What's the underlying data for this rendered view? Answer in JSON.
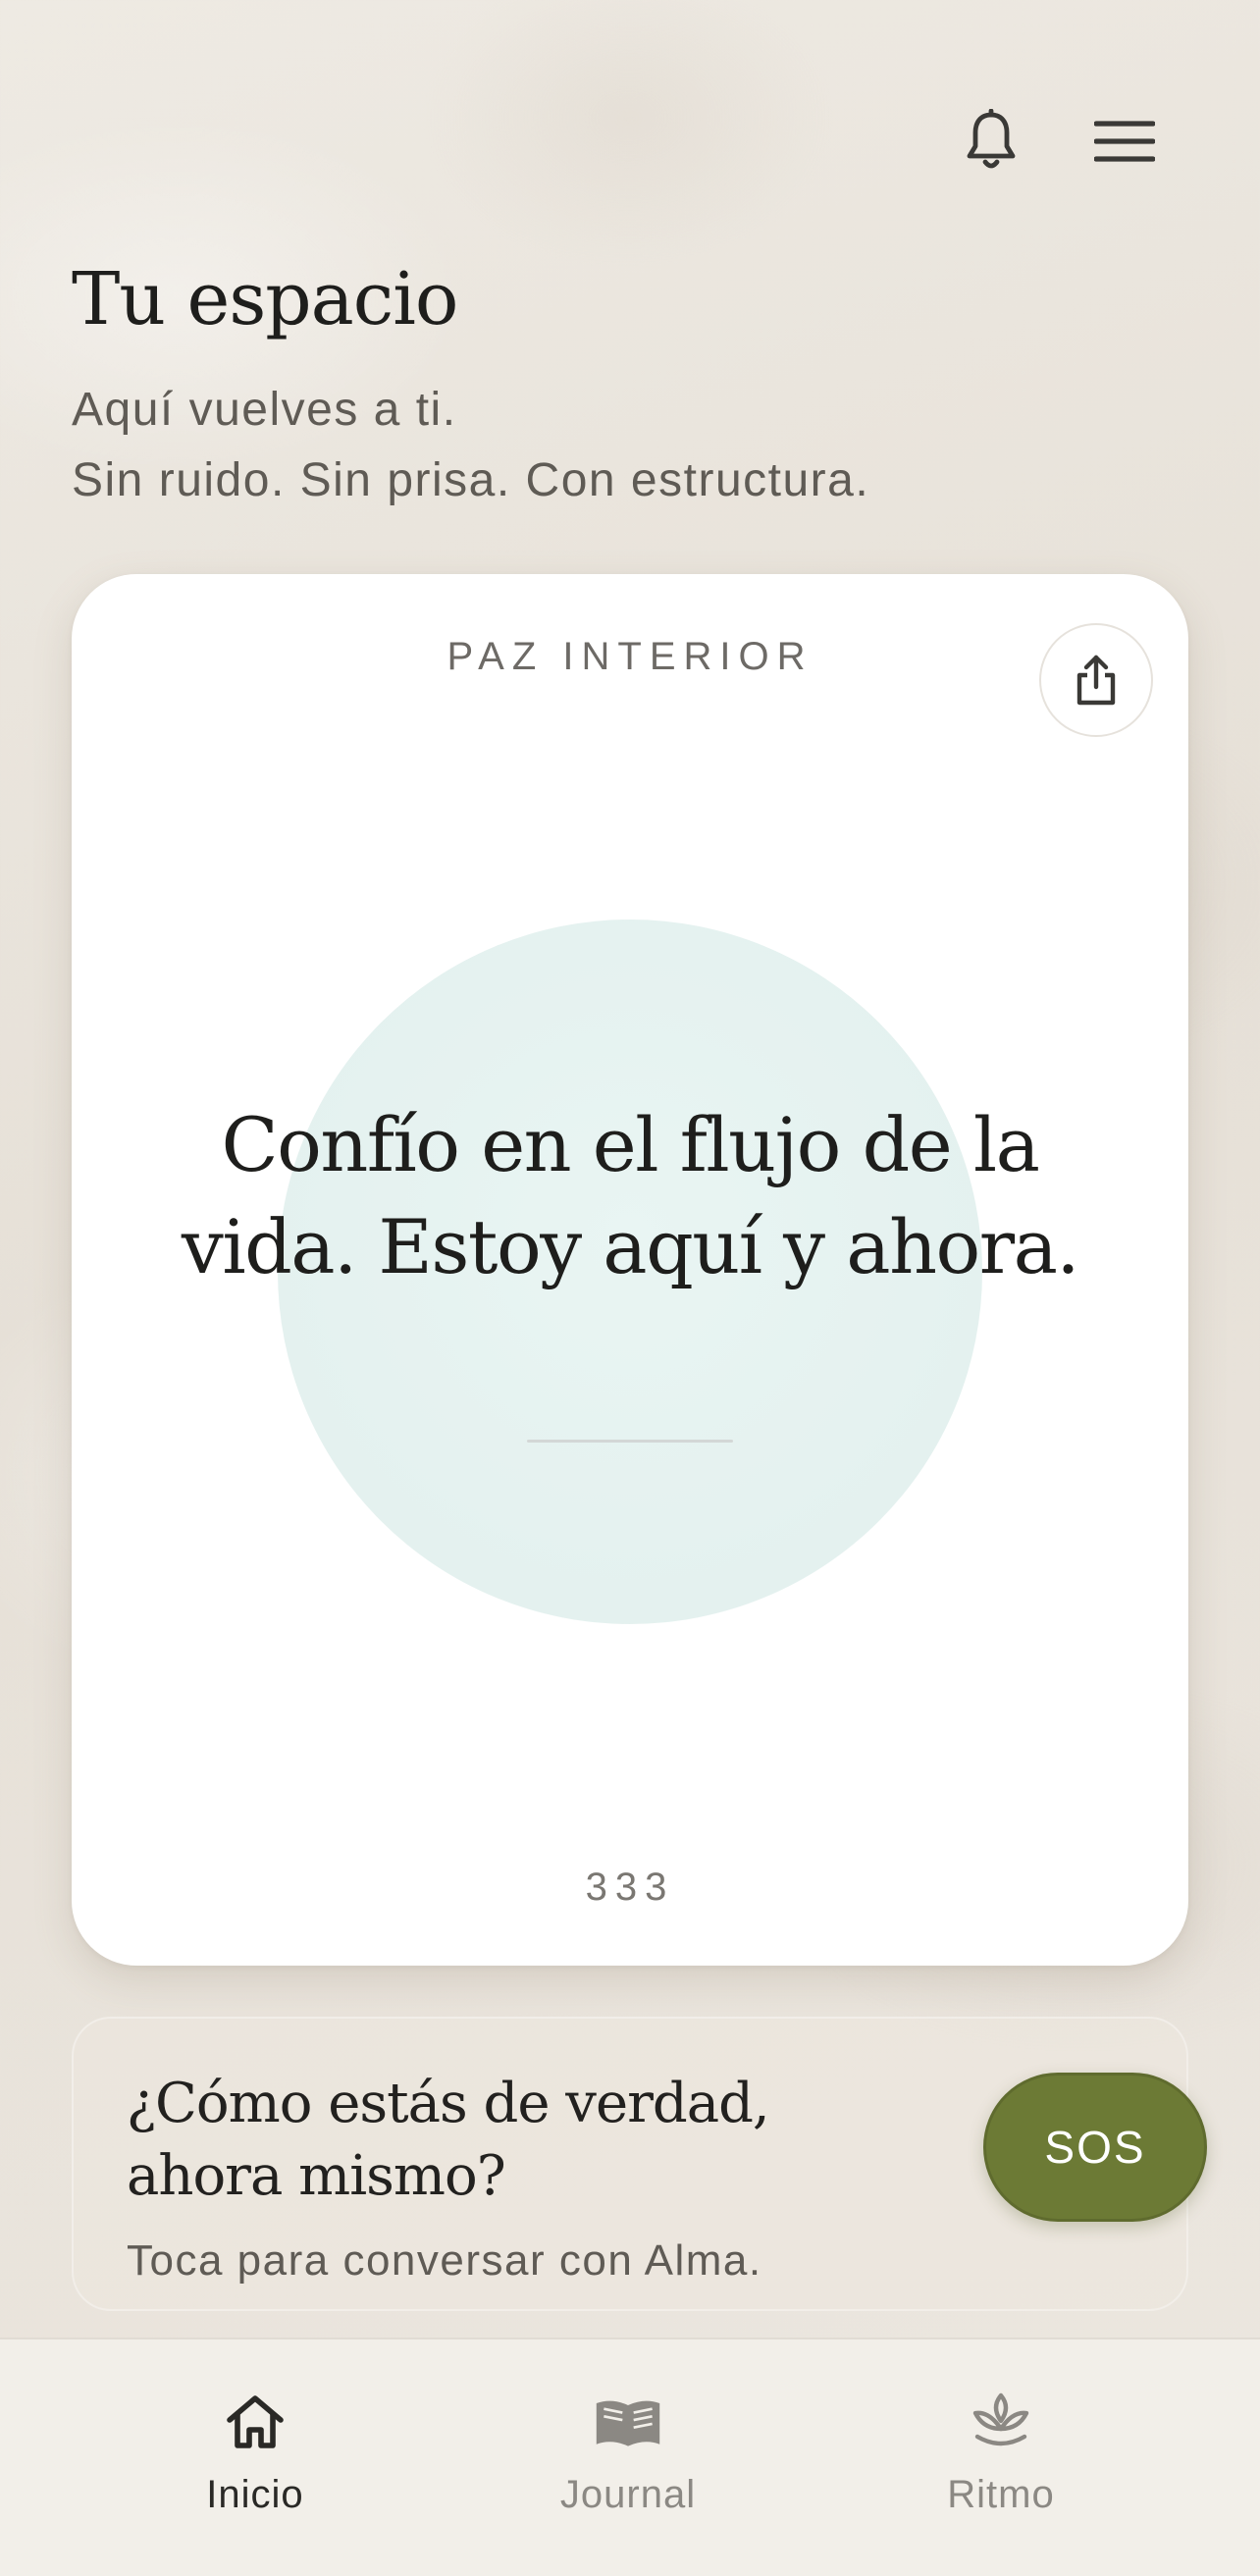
{
  "header": {
    "title": "Tu espacio",
    "subtitle_line1": "Aquí vuelves a ti.",
    "subtitle_line2": "Sin ruido. Sin prisa. Con estructura.",
    "icons": [
      "bell-icon",
      "menu-icon"
    ]
  },
  "affirmation_card": {
    "category": "PAZ INTERIOR",
    "text": "Confío en el flujo de la vida. Estoy aquí y ahora.",
    "number": "333",
    "share_icon": "share-icon",
    "circle_color": "#e6f3f1"
  },
  "checkin": {
    "question": "¿Cómo estás de verdad, ahora mismo?",
    "hint": "Toca para conversar con Alma.",
    "sos_label": "SOS"
  },
  "nav": {
    "items": [
      {
        "label": "Inicio",
        "icon": "home-icon",
        "active": true
      },
      {
        "label": "Journal",
        "icon": "book-icon",
        "active": false
      },
      {
        "label": "Ritmo",
        "icon": "lotus-icon",
        "active": false
      }
    ]
  },
  "colors": {
    "accent_sos": "#6c7a35",
    "background": "#ebe6de",
    "card": "#ffffff",
    "text_primary": "#1e1e1c",
    "text_secondary": "#5f5b55"
  }
}
